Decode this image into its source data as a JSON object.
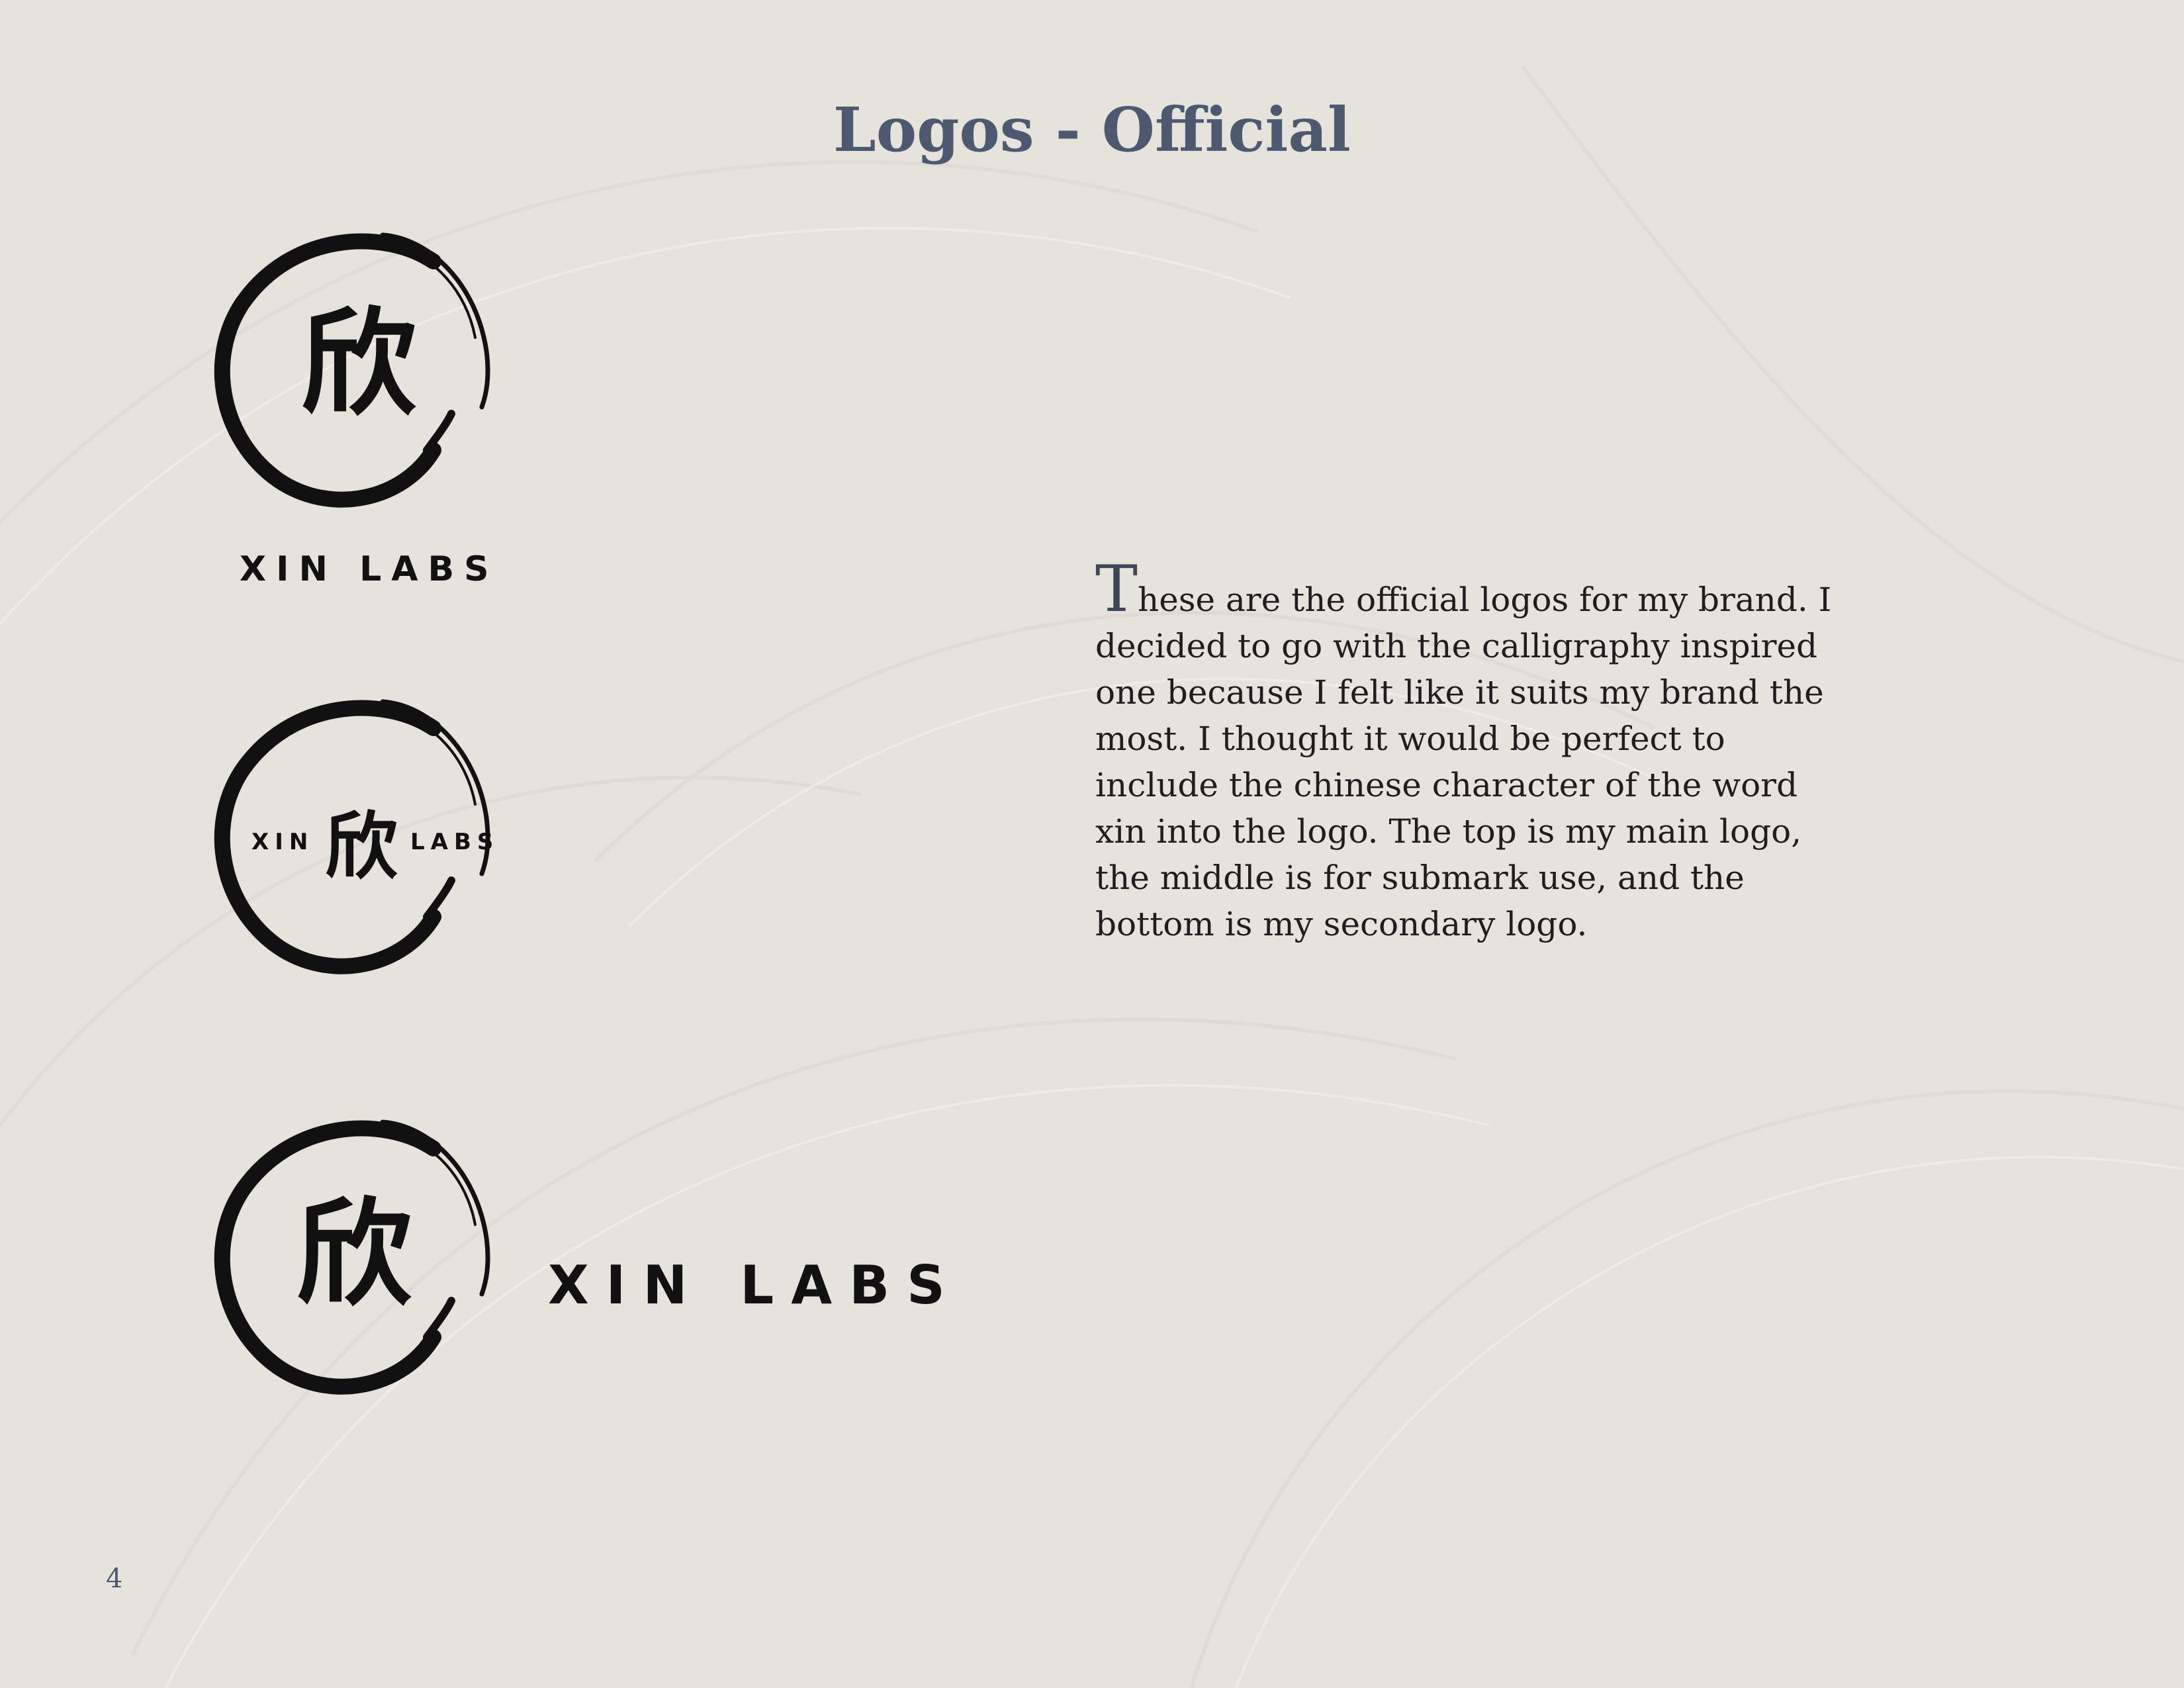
{
  "page": {
    "title": "Logos - Official",
    "page_number": "4"
  },
  "description": {
    "drop_cap": "T",
    "text": "hese are the official logos for my brand. I decided to go with the calligraphy inspired one because I felt like it suits my brand the most. I thought it would be perfect to include the chinese character of the word xin into the logo. The top is my main logo, the middle is for submark use, and the bottom is my secondary logo."
  },
  "logos": {
    "main": {
      "character": "欣",
      "wordmark": "XIN LABS"
    },
    "submark": {
      "character": "欣",
      "wordmark_left": "XIN",
      "wordmark_right": "LABS"
    },
    "secondary": {
      "character": "欣",
      "wordmark": "XIN LABS"
    }
  },
  "colors": {
    "background": "#e6e3dd",
    "title": "#4d596e",
    "ink": "#111111",
    "body_text": "#1e1e1e"
  },
  "icons": {
    "logo_mark": "enso-brush-circle-icon"
  }
}
